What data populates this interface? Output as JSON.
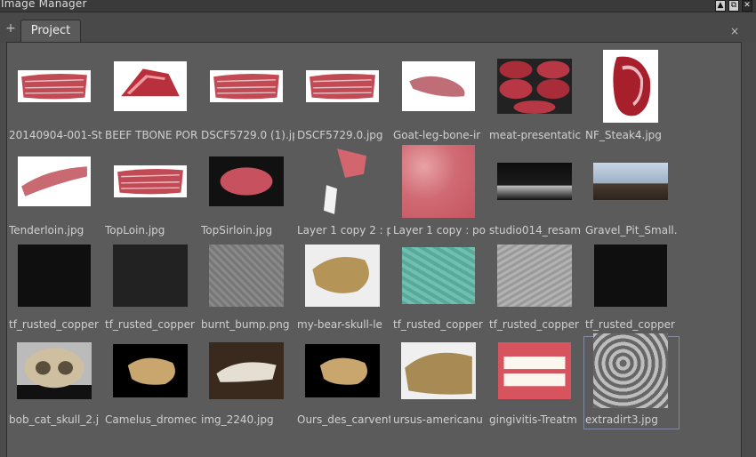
{
  "window": {
    "title": "Image Manager"
  },
  "tabs": [
    {
      "label": "Project"
    }
  ],
  "icons": {
    "add": "plus-icon",
    "close": "close-icon",
    "window_buttons": [
      "triangle-up-icon",
      "restore-icon",
      "close-window-icon"
    ]
  },
  "window_buttons": {
    "collapse": "▲",
    "restore": "⧉",
    "close": "✕"
  },
  "add_symbol": "+",
  "close_symbol": "×",
  "images": [
    {
      "label": "20140904-001-St",
      "kind": "meat-rack"
    },
    {
      "label": "BEEF TBONE POR",
      "kind": "meat-chunk"
    },
    {
      "label": "DSCF5729.0 (1).jp",
      "kind": "meat-rack"
    },
    {
      "label": "DSCF5729.0.jpg",
      "kind": "meat-rack"
    },
    {
      "label": "Goat-leg-bone-ir",
      "kind": "meat-leg"
    },
    {
      "label": "meat-presentatic",
      "kind": "meat-grid"
    },
    {
      "label": "NF_Steak4.jpg",
      "kind": "steak"
    },
    {
      "label": "Tenderloin.jpg",
      "kind": "meat-long"
    },
    {
      "label": "TopLoin.jpg",
      "kind": "meat-rack"
    },
    {
      "label": "TopSirloin.jpg",
      "kind": "sirloin"
    },
    {
      "label": "Layer 1 copy 2 : p",
      "kind": "layer-fragment"
    },
    {
      "label": "Layer 1 copy : po",
      "kind": "pink-texture"
    },
    {
      "label": "studio014_resam",
      "kind": "studio"
    },
    {
      "label": "Gravel_Pit_Small.",
      "kind": "landscape"
    },
    {
      "label": "tf_rusted_copper",
      "kind": "black-texture"
    },
    {
      "label": "tf_rusted_copper",
      "kind": "dark-texture"
    },
    {
      "label": "burnt_bump.png",
      "kind": "gray-texture"
    },
    {
      "label": "my-bear-skull-le",
      "kind": "skull-light"
    },
    {
      "label": "tf_rusted_copper",
      "kind": "teal-texture"
    },
    {
      "label": "tf_rusted_copper",
      "kind": "light-gray-texture"
    },
    {
      "label": "tf_rusted_copper",
      "kind": "black-texture"
    },
    {
      "label": "bob_cat_skull_2.j",
      "kind": "skull-front"
    },
    {
      "label": "Camelus_dromec",
      "kind": "skull-black"
    },
    {
      "label": "img_2240.jpg",
      "kind": "skull-ground"
    },
    {
      "label": "Ours_des_carvent",
      "kind": "skull-black"
    },
    {
      "label": "ursus-americanu",
      "kind": "skull-bear"
    },
    {
      "label": "gingivitis-Treatm",
      "kind": "teeth"
    },
    {
      "label": "extradirt3.jpg",
      "kind": "dirt",
      "selected": true
    }
  ]
}
